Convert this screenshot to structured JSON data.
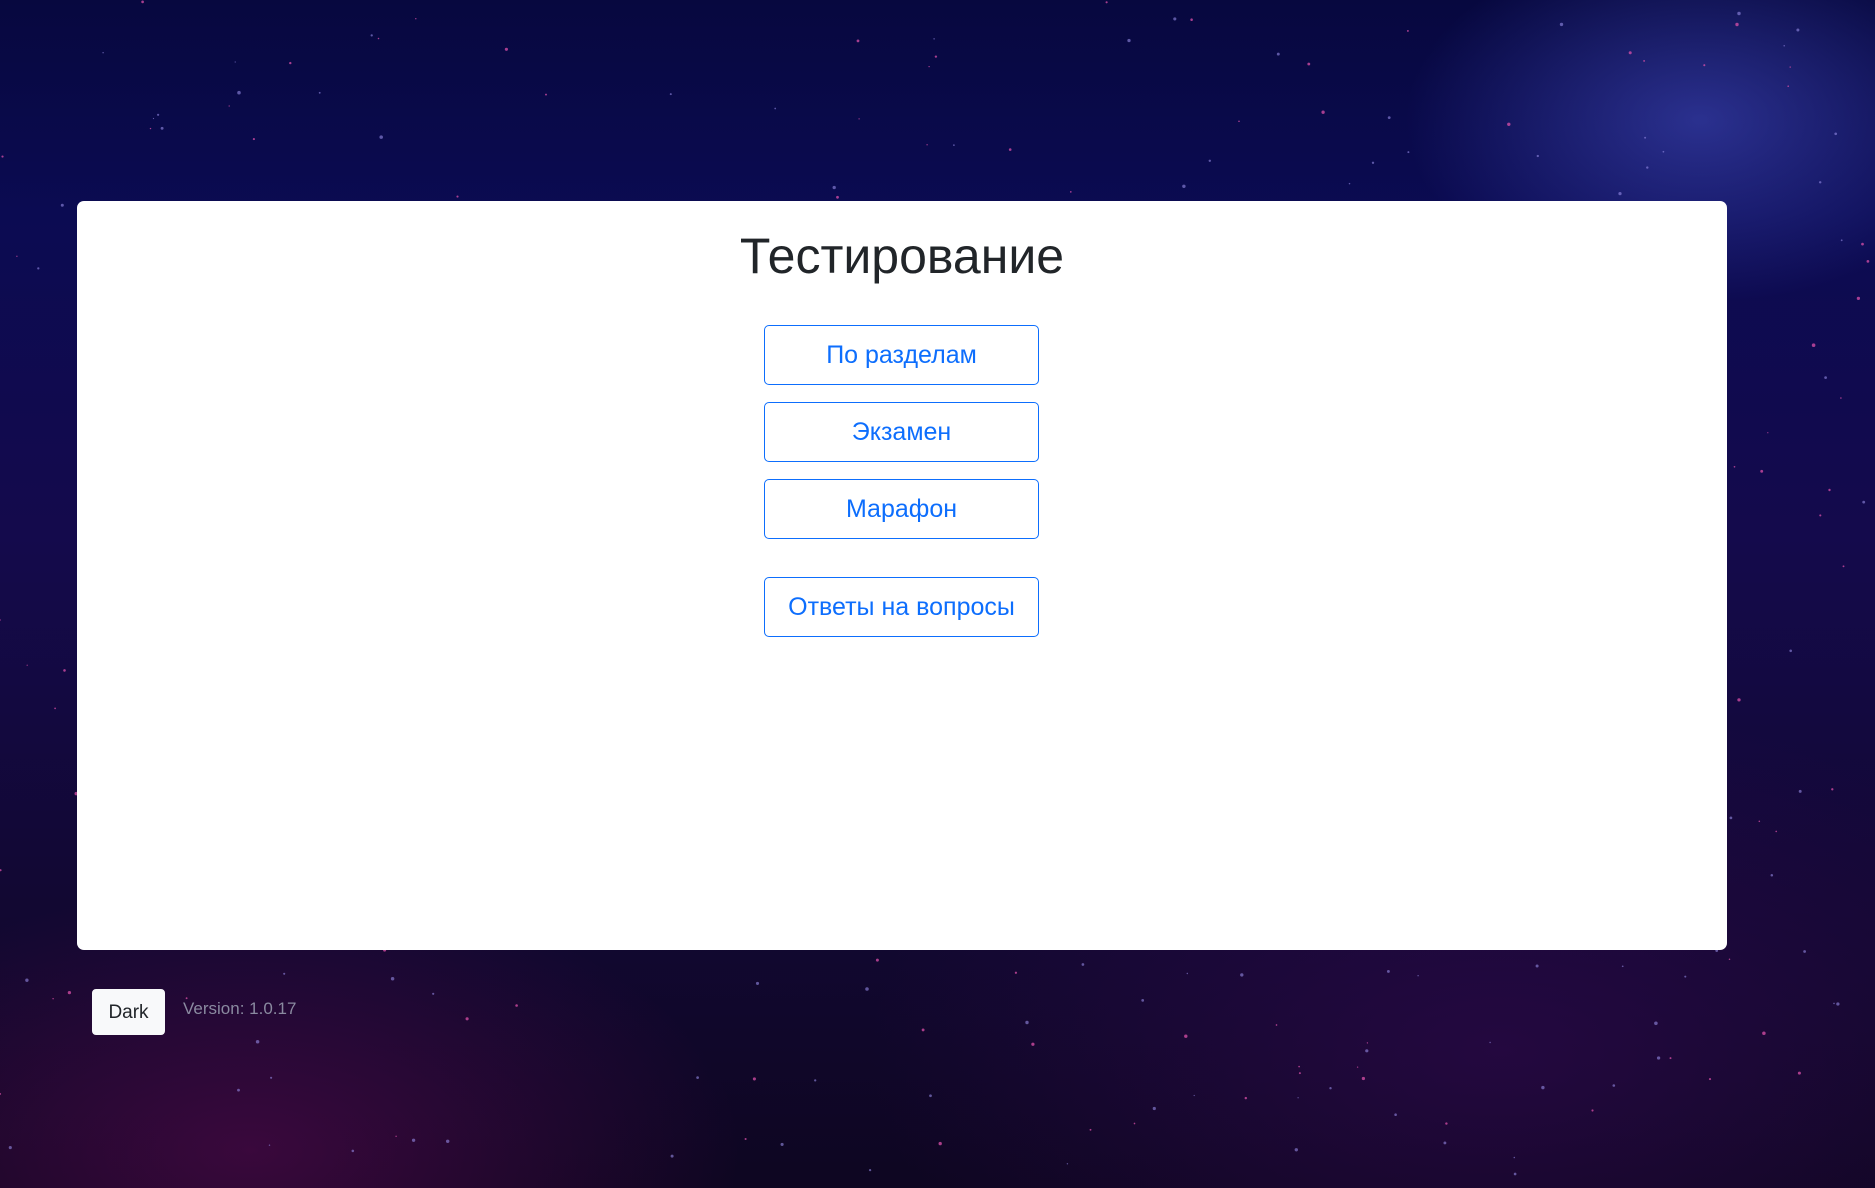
{
  "page": {
    "title": "Тестирование"
  },
  "menu": {
    "by_sections": "По разделам",
    "exam": "Экзамен",
    "marathon": "Марафон",
    "answers": "Ответы на вопросы"
  },
  "footer": {
    "theme_button": "Dark",
    "version": "Version: 1.0.17"
  },
  "colors": {
    "accent": "#0d6efd",
    "title_text": "#212529",
    "card_background": "#ffffff",
    "page_background": "#0b0b52"
  }
}
